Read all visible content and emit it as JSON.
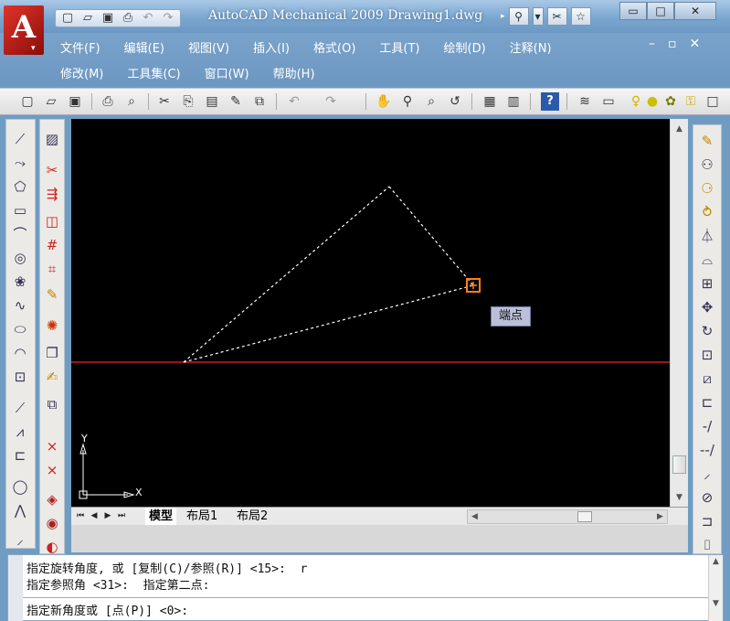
{
  "window": {
    "title": "AutoCAD Mechanical 2009 Drawing1.dwg",
    "app_logo_letter": "A",
    "quick_access_icons": [
      "new-icon",
      "open-icon",
      "save-icon",
      "print-icon",
      "undo-icon",
      "redo-icon"
    ],
    "title_tools": [
      "search-icon",
      "settings-icon",
      "star-icon"
    ],
    "controls": [
      "minimize",
      "maximize",
      "close"
    ],
    "control_glyphs": [
      "▭",
      "□",
      "✕"
    ]
  },
  "menu": {
    "row1": [
      "文件(F)",
      "编辑(E)",
      "视图(V)",
      "插入(I)",
      "格式(O)",
      "工具(T)",
      "绘制(D)",
      "注释(N)"
    ],
    "row2": [
      "修改(M)",
      "工具集(C)",
      "窗口(W)",
      "帮助(H)"
    ],
    "doc_controls": [
      "–",
      "▫",
      "✕"
    ]
  },
  "canvas": {
    "snap_tooltip": "端点",
    "ucs_x": "X",
    "ucs_y": "Y",
    "colors": {
      "background": "#000000",
      "axis_line": "#d11a1a",
      "dashed_preview": "#ffffff",
      "snap_marker": "#ff7f1f"
    }
  },
  "tabs": {
    "model": "模型",
    "layout1": "布局1",
    "layout2": "布局2"
  },
  "command": {
    "history": [
      "指定旋转角度, 或 [复制(C)/参照(R)] <15>:  r",
      "指定参照角 <31>:  指定第二点:"
    ],
    "prompt": "指定新角度或 [点(P)] <0>:"
  }
}
